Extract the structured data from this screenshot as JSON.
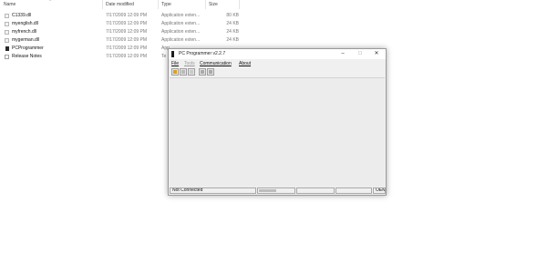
{
  "explorer": {
    "columns": {
      "name": "Name",
      "date": "Date modified",
      "type": "Type",
      "size": "Size"
    },
    "files": [
      {
        "name": "C1339.dll",
        "date": "7/17/2009 12:09 PM",
        "type": "Application exten...",
        "size": "80 KB",
        "icon": "dll-file-icon"
      },
      {
        "name": "myenglish.dll",
        "date": "7/17/2009 12:09 PM",
        "type": "Application exten...",
        "size": "24 KB",
        "icon": "dll-file-icon"
      },
      {
        "name": "myfrench.dll",
        "date": "7/17/2009 12:09 PM",
        "type": "Application exten...",
        "size": "24 KB",
        "icon": "dll-file-icon"
      },
      {
        "name": "mygerman.dll",
        "date": "7/17/2009 12:09 PM",
        "type": "Application exten...",
        "size": "24 KB",
        "icon": "dll-file-icon"
      },
      {
        "name": "PCProgrammer",
        "date": "7/17/2009 12:09 PM",
        "type": "App",
        "size": "",
        "icon": "exe-file-icon"
      },
      {
        "name": "Release Notes",
        "date": "7/17/2009 12:09 PM",
        "type": "Te",
        "size": "",
        "icon": "text-file-icon"
      }
    ]
  },
  "window": {
    "title": "PC Programmer v2.2.7",
    "menu": [
      {
        "label": "File",
        "enabled": true
      },
      {
        "label": "Tools",
        "enabled": false
      },
      {
        "label": "Communication",
        "enabled": true
      },
      {
        "label": "About",
        "enabled": true
      }
    ],
    "toolbar": [
      {
        "icon": "open-folder-icon",
        "enabled": true
      },
      {
        "icon": "save-icon",
        "enabled": false
      },
      {
        "icon": "upload-icon",
        "enabled": false
      },
      {
        "icon": "read-device-icon",
        "enabled": false
      },
      {
        "icon": "write-device-icon",
        "enabled": false
      }
    ],
    "status": {
      "connection": "Not Connected",
      "progress": 0.5,
      "oem": "OEM"
    },
    "caption": {
      "minimize": "–",
      "maximize": "☐",
      "close": "✕"
    }
  },
  "colors": {
    "folder": "#d9a21b",
    "window_bg": "#f0f0f0",
    "content_bg": "#ececec"
  }
}
